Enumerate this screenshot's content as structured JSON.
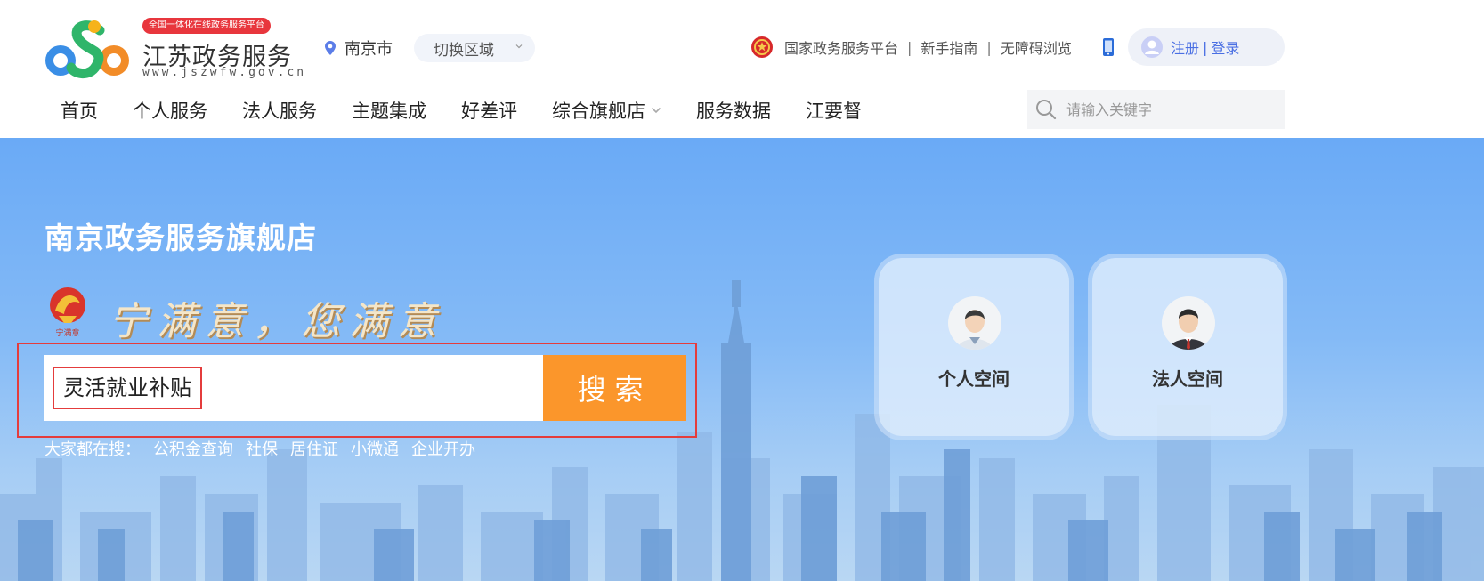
{
  "header": {
    "logo_badge": "全国一体化在线政务服务平台",
    "logo_name": "江苏政务服务",
    "logo_url": "www.jszwfw.gov.cn",
    "city": "南京市",
    "switch_region": "切换区域",
    "links": {
      "national_platform": "国家政务服务平台",
      "sep1": "|",
      "guide": "新手指南",
      "sep2": "|",
      "accessibility": "无障碍浏览"
    },
    "account": {
      "register": "注册",
      "sep": "|",
      "login": "登录"
    }
  },
  "nav": {
    "items": [
      "首页",
      "个人服务",
      "法人服务",
      "主题集成",
      "好差评",
      "综合旗舰店",
      "服务数据",
      "江要督"
    ],
    "search_placeholder": "请输入关键字"
  },
  "hero": {
    "title": "南京政务服务旗舰店",
    "slogan_logo_text": "宁满意",
    "slogan": "宁满意，您满意",
    "search_value": "灵活就业补贴",
    "search_button": "搜索",
    "hot_label": "大家都在搜：",
    "hot_items": [
      "公积金查询",
      "社保",
      "居住证",
      "小微通",
      "企业开办"
    ],
    "cards": {
      "personal": "个人空间",
      "corporate": "法人空间"
    }
  },
  "colors": {
    "accent_orange": "#fb962b",
    "link_blue": "#4a6fe3",
    "highlight_red": "#e43c3c",
    "hero_blue": "#6aaaf6"
  }
}
